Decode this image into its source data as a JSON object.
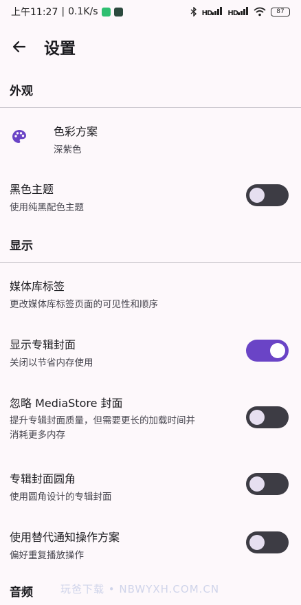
{
  "status": {
    "time": "上午11:27",
    "speed": "0.1K/s",
    "signal1": "HD",
    "signal2": "HD",
    "battery": "87"
  },
  "appbar": {
    "title": "设置"
  },
  "sections": {
    "appearance": "外观",
    "display": "显示",
    "audio": "音频"
  },
  "items": {
    "color_scheme": {
      "title": "色彩方案",
      "sub": "深紫色"
    },
    "black_theme": {
      "title": "黑色主题",
      "sub": "使用纯黑配色主题"
    },
    "library_tabs": {
      "title": "媒体库标签",
      "sub": "更改媒体库标签页面的可见性和顺序"
    },
    "show_cover": {
      "title": "显示专辑封面",
      "sub": "关闭以节省内存使用"
    },
    "ignore_mediastore": {
      "title": "忽略 MediaStore 封面",
      "sub_line1": "提升专辑封面质量，但需要更长的加载时间并",
      "sub_line2": "消耗更多内存"
    },
    "rounded_cover": {
      "title": "专辑封面圆角",
      "sub": "使用圆角设计的专辑封面"
    },
    "alt_notification": {
      "title": "使用替代通知操作方案",
      "sub": "偏好重复播放操作"
    }
  },
  "toggles": {
    "black_theme": false,
    "show_cover": true,
    "ignore_mediastore": false,
    "rounded_cover": false,
    "alt_notification": false
  },
  "watermark": "玩爸下载 • NBWYXH.COM.CN",
  "colors": {
    "accent": "#6a44c6",
    "background": "#fdf8fb",
    "switch_off": "#3d3c44"
  },
  "icons": {
    "back": "arrow-left-icon",
    "palette": "palette-icon"
  }
}
